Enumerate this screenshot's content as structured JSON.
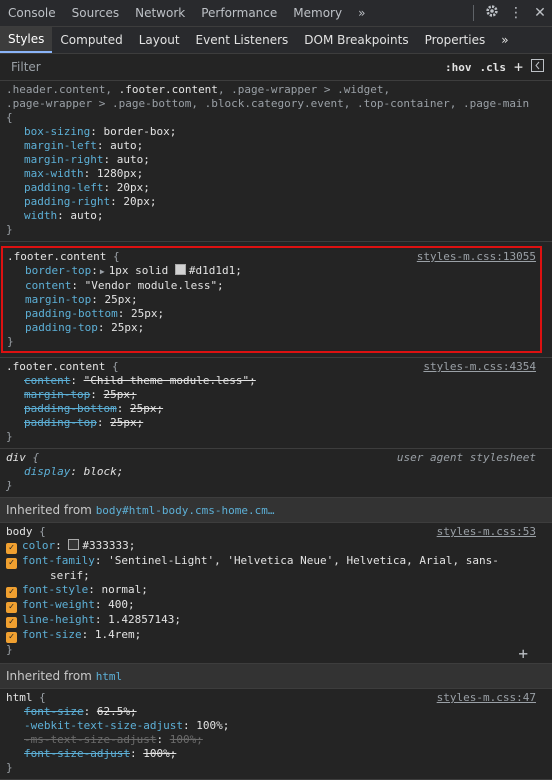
{
  "top_tabs": [
    "Console",
    "Sources",
    "Network",
    "Performance",
    "Memory"
  ],
  "top_more": "»",
  "sub_tabs": [
    "Styles",
    "Computed",
    "Layout",
    "Event Listeners",
    "DOM Breakpoints",
    "Properties"
  ],
  "sub_more": "»",
  "filter": {
    "placeholder": "Filter",
    "hov": ":hov",
    "cls": ".cls",
    "add": "+"
  },
  "rule1": {
    "sel_a": ".header.content, ",
    "sel_b": ".footer.content",
    "sel_c": ", .page-wrapper > .widget,",
    "sel_line2": ".page-wrapper > .page-bottom, .block.category.event, .top-container, .page-main",
    "open": "{",
    "close": "}",
    "props": [
      {
        "n": "box-sizing",
        "v": "border-box;"
      },
      {
        "n": "margin-left",
        "v": "auto;"
      },
      {
        "n": "margin-right",
        "v": "auto;"
      },
      {
        "n": "max-width",
        "v": "1280px;"
      },
      {
        "n": "padding-left",
        "v": "20px;"
      },
      {
        "n": "padding-right",
        "v": "20px;"
      },
      {
        "n": "width",
        "v": "auto;"
      }
    ]
  },
  "rule2": {
    "selector": ".footer.content",
    "open": "{",
    "close": "}",
    "source": "styles-m.css:13055",
    "border_top": {
      "n": "border-top",
      "v1": "1px solid",
      "v2": "#d1d1d1;",
      "swatch": "#d1d1d1"
    },
    "props": [
      {
        "n": "content",
        "v": "\"Vendor module.less\";"
      },
      {
        "n": "margin-top",
        "v": "25px;"
      },
      {
        "n": "padding-bottom",
        "v": "25px;"
      },
      {
        "n": "padding-top",
        "v": "25px;"
      }
    ]
  },
  "rule3": {
    "selector": ".footer.content",
    "open": "{",
    "close": "}",
    "source": "styles-m.css:4354",
    "props": [
      {
        "n": "content",
        "v": "\"Child theme module.less\";"
      },
      {
        "n": "margin-top",
        "v": "25px;"
      },
      {
        "n": "padding-bottom",
        "v": "25px;"
      },
      {
        "n": "padding-top",
        "v": "25px;"
      }
    ]
  },
  "rule4": {
    "selector": "div",
    "open": "{",
    "close": "}",
    "source": "user agent stylesheet",
    "props": [
      {
        "n": "display",
        "v": "block;"
      }
    ]
  },
  "inherited1": {
    "label": "Inherited from",
    "node": "body#html-body.cms-home.cm…"
  },
  "rule5": {
    "selector": "body",
    "open": "{",
    "close": "}",
    "source": "styles-m.css:53",
    "color": {
      "n": "color",
      "v": "#333333;",
      "swatch": "#333333"
    },
    "font_family": {
      "n": "font-family",
      "v": "'Sentinel-Light', 'Helvetica Neue', Helvetica, Arial, sans-",
      "v2": "serif;"
    },
    "props": [
      {
        "n": "font-style",
        "v": "normal;"
      },
      {
        "n": "font-weight",
        "v": "400;"
      },
      {
        "n": "line-height",
        "v": "1.42857143;"
      },
      {
        "n": "font-size",
        "v": "1.4rem;"
      }
    ],
    "add": "+"
  },
  "inherited2": {
    "label": "Inherited from",
    "node": "html"
  },
  "rule6": {
    "selector": "html",
    "open": "{",
    "close": "}",
    "source": "styles-m.css:47",
    "props": [
      {
        "n": "font-size",
        "v": "62.5%;"
      },
      {
        "n": "-webkit-text-size-adjust",
        "v": "100%;"
      },
      {
        "n": "-ms-text-size-adjust",
        "v": "100%;"
      },
      {
        "n": "font-size-adjust",
        "v": "100%;"
      }
    ]
  },
  "colors": {
    "accent": "#8ab4f8",
    "prop": "#5db0d7",
    "highlight": "#d11111",
    "checkbox": "#f0a030"
  }
}
